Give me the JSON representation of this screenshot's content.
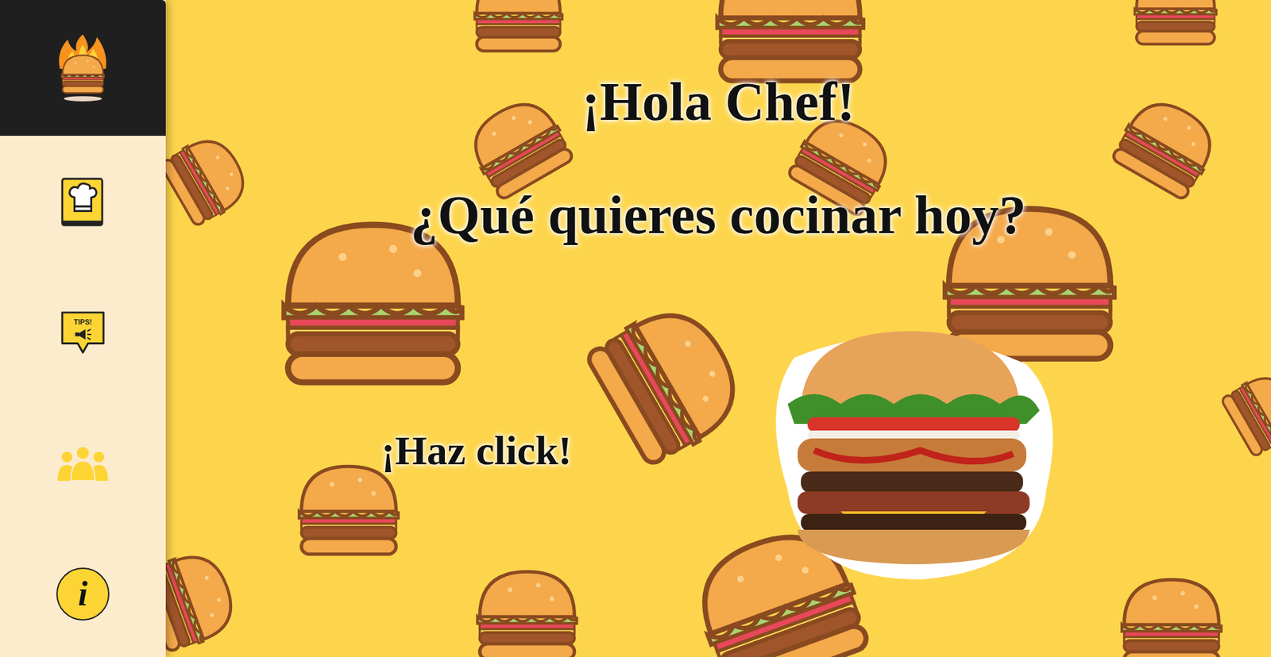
{
  "sidebar": {
    "items": [
      {
        "kind": "recipes"
      },
      {
        "kind": "tips",
        "text": "TIPS!"
      },
      {
        "kind": "community"
      },
      {
        "kind": "info",
        "text": "i"
      }
    ]
  },
  "hero": {
    "greeting": "¡Hola Chef!",
    "question": "¿Qué quieres cocinar hoy?",
    "cta": "¡Haz click!"
  }
}
